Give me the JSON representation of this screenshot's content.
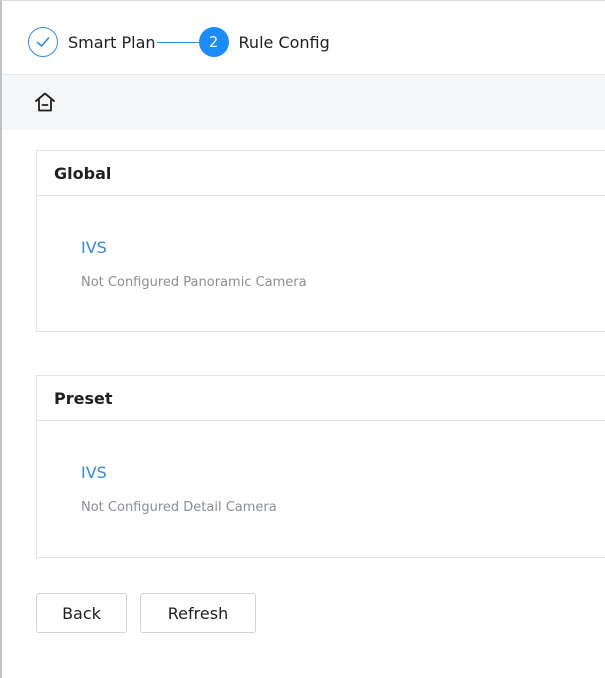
{
  "stepper": {
    "steps": [
      {
        "label": "Smart Plan",
        "status": "done",
        "icon": "check-icon"
      },
      {
        "label": "Rule Config",
        "status": "active",
        "number": "2"
      }
    ],
    "accent_color": "#1a8cff"
  },
  "home_bar": {
    "icon": "home-icon"
  },
  "sections": [
    {
      "title": "Global",
      "link": "IVS",
      "description": "Not Configured Panoramic Camera"
    },
    {
      "title": "Preset",
      "link": "IVS",
      "description": "Not Configured Detail Camera"
    }
  ],
  "buttons": {
    "back_label": "Back",
    "refresh_label": "Refresh"
  }
}
